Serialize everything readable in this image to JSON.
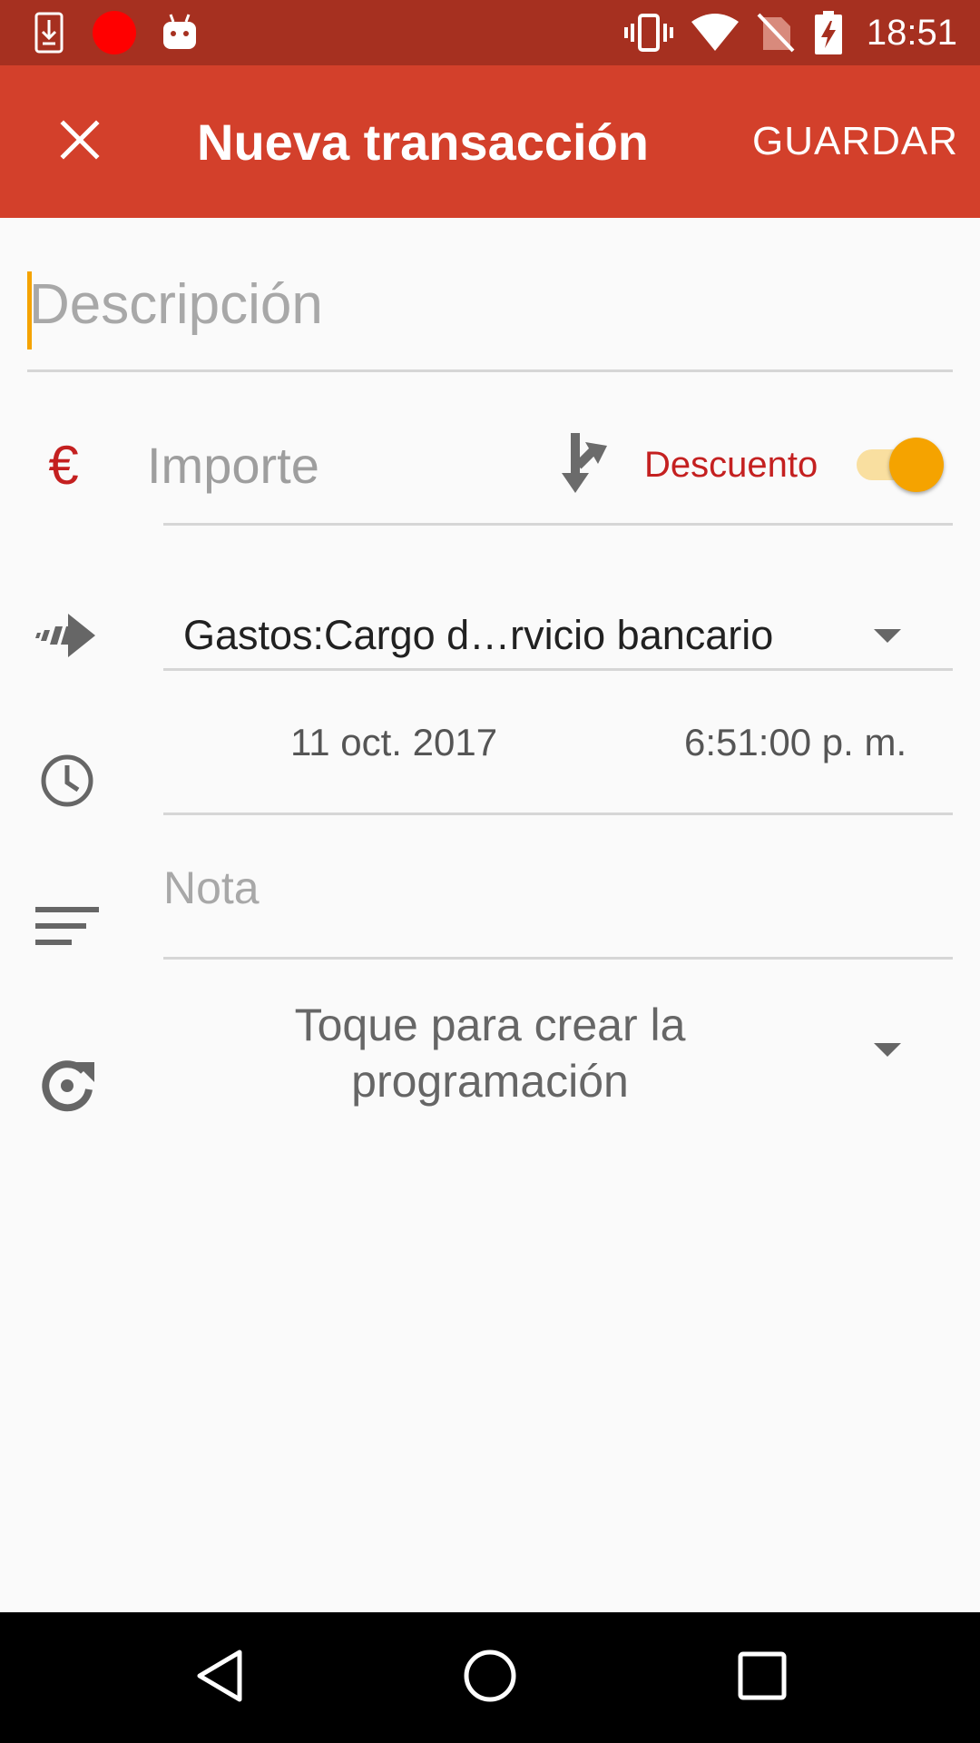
{
  "status_bar": {
    "time": "18:51",
    "left_icons": [
      "download-notification-icon",
      "recording-dot-icon",
      "android-icon"
    ],
    "right_icons": [
      "vibrate-icon",
      "wifi-icon",
      "no-sim-icon",
      "battery-charging-icon"
    ]
  },
  "app_bar": {
    "close_icon": "close-icon",
    "title": "Nueva transacción",
    "save_label": "GUARDAR"
  },
  "form": {
    "description": {
      "placeholder": "Descripción",
      "value": ""
    },
    "amount": {
      "currency_symbol": "€",
      "placeholder": "Importe",
      "value": "",
      "split_icon": "split-arrow-icon",
      "type_label": "Descuento",
      "toggle_on": true
    },
    "account": {
      "icon": "transfer-arrow-icon",
      "selected": "Gastos:Cargo d…rvicio bancario"
    },
    "datetime": {
      "icon": "clock-icon",
      "date": "11 oct. 2017",
      "time": "6:51:00 p. m."
    },
    "note": {
      "icon": "notes-icon",
      "placeholder": "Nota",
      "value": ""
    },
    "schedule": {
      "icon": "recurrence-icon",
      "line1": "Toque para crear la",
      "line2": "programación"
    }
  },
  "nav_bar": {
    "buttons": [
      "back-icon",
      "home-icon",
      "recents-icon"
    ]
  },
  "colors": {
    "status_bar": "#a63020",
    "app_bar": "#d3402b",
    "accent": "#f5a300",
    "discount_red": "#c42020",
    "background": "#fafafa"
  }
}
